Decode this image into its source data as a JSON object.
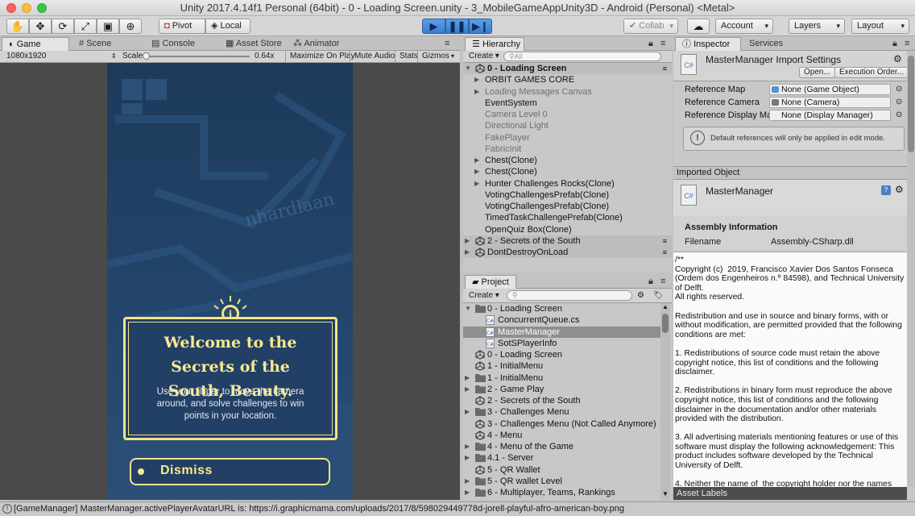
{
  "window": {
    "title": "Unity 2017.4.14f1 Personal (64bit) - 0 - Loading Screen.unity - 3_MobileGameAppUnity3D - Android (Personal) <Metal>"
  },
  "toolbar": {
    "pivot": "Pivot",
    "local": "Local",
    "collab": "Collab",
    "account": "Account",
    "layers": "Layers",
    "layout": "Layout"
  },
  "game": {
    "tabs": [
      "Game",
      "Scene",
      "Console",
      "Asset Store",
      "Animator"
    ],
    "resolution": "1080x1920",
    "scale_label": "Scale",
    "scale_value": "0.64x",
    "options": [
      "Maximize On Play",
      "Mute Audio",
      "Stats",
      "Gizmos"
    ],
    "map_text": "nhardlaan",
    "dialog": {
      "title": "Welcome to the Secrets of the South, Beauty.",
      "body": "Use your finger to move the camera around, and solve challenges to win points in your location."
    },
    "dismiss": "Dismiss"
  },
  "hierarchy": {
    "title": "Hierarchy",
    "create": "Create",
    "search": "All",
    "items": [
      {
        "label": "0 - Loading Screen",
        "depth": 0,
        "arrow": "open",
        "type": "scene",
        "dim": false,
        "bold": true
      },
      {
        "label": "ORBIT GAMES CORE",
        "depth": 1,
        "arrow": "closed",
        "dim": false
      },
      {
        "label": "Loading Messages Canvas",
        "depth": 1,
        "arrow": "closed",
        "dim": true
      },
      {
        "label": "EventSystem",
        "depth": 1,
        "arrow": "",
        "dim": false
      },
      {
        "label": "Camera Level 0",
        "depth": 1,
        "arrow": "",
        "dim": true
      },
      {
        "label": "Directional Light",
        "depth": 1,
        "arrow": "",
        "dim": true
      },
      {
        "label": "FakePlayer",
        "depth": 1,
        "arrow": "",
        "dim": true
      },
      {
        "label": "FabricInit",
        "depth": 1,
        "arrow": "",
        "dim": true
      },
      {
        "label": "Chest(Clone)",
        "depth": 1,
        "arrow": "closed",
        "dim": false
      },
      {
        "label": "Chest(Clone)",
        "depth": 1,
        "arrow": "closed",
        "dim": false
      },
      {
        "label": "Hunter Challenges Rocks(Clone)",
        "depth": 1,
        "arrow": "closed",
        "dim": false
      },
      {
        "label": "VotingChallengesPrefab(Clone)",
        "depth": 1,
        "arrow": "",
        "dim": false
      },
      {
        "label": "VotingChallengesPrefab(Clone)",
        "depth": 1,
        "arrow": "",
        "dim": false
      },
      {
        "label": "TimedTaskChallengePrefab(Clone)",
        "depth": 1,
        "arrow": "",
        "dim": false
      },
      {
        "label": "OpenQuiz Box(Clone)",
        "depth": 1,
        "arrow": "",
        "dim": false
      },
      {
        "label": "2 - Secrets of the South",
        "depth": 0,
        "arrow": "closed",
        "type": "scene",
        "dim": false
      },
      {
        "label": "DontDestroyOnLoad",
        "depth": 0,
        "arrow": "closed",
        "type": "scene",
        "dim": false
      }
    ]
  },
  "project": {
    "title": "Project",
    "create": "Create",
    "items": [
      {
        "label": "0 - Loading Screen",
        "depth": 0,
        "arrow": "open",
        "type": "folder"
      },
      {
        "label": "ConcurrentQueue.cs",
        "depth": 1,
        "arrow": "",
        "type": "script"
      },
      {
        "label": "MasterManager",
        "depth": 1,
        "arrow": "",
        "type": "script",
        "selected": true
      },
      {
        "label": "SotSPlayerInfo",
        "depth": 1,
        "arrow": "",
        "type": "script"
      },
      {
        "label": "0 - Loading Screen",
        "depth": 0,
        "arrow": "",
        "type": "scene"
      },
      {
        "label": "1 - InitialMenu",
        "depth": 0,
        "arrow": "",
        "type": "scene"
      },
      {
        "label": "1 - InitialMenu",
        "depth": 0,
        "arrow": "closed",
        "type": "folder"
      },
      {
        "label": "2 - Game Play",
        "depth": 0,
        "arrow": "closed",
        "type": "folder"
      },
      {
        "label": "2 - Secrets of the South",
        "depth": 0,
        "arrow": "",
        "type": "scene"
      },
      {
        "label": "3 - Challenges Menu",
        "depth": 0,
        "arrow": "closed",
        "type": "folder"
      },
      {
        "label": "3 - Challenges Menu (Not Called Anymore)",
        "depth": 0,
        "arrow": "",
        "type": "scene"
      },
      {
        "label": "4 - Menu",
        "depth": 0,
        "arrow": "",
        "type": "scene"
      },
      {
        "label": "4 - Menu of the Game",
        "depth": 0,
        "arrow": "closed",
        "type": "folder"
      },
      {
        "label": "4.1 - Server",
        "depth": 0,
        "arrow": "closed",
        "type": "folder"
      },
      {
        "label": "5 - QR Wallet",
        "depth": 0,
        "arrow": "",
        "type": "scene"
      },
      {
        "label": "5 - QR wallet Level",
        "depth": 0,
        "arrow": "closed",
        "type": "folder"
      },
      {
        "label": "6 - Multiplayer, Teams, Rankings",
        "depth": 0,
        "arrow": "closed",
        "type": "folder"
      }
    ]
  },
  "inspector": {
    "tabs": [
      "Inspector",
      "Services"
    ],
    "header": "MasterManager Import Settings",
    "open_btn": "Open...",
    "exec_btn": "Execution Order...",
    "fields": [
      {
        "label": "Reference Map",
        "value": "None (Game Object)"
      },
      {
        "label": "Reference Camera",
        "value": "None (Camera)"
      },
      {
        "label": "Reference Display Mar",
        "value": "None (Display Manager)"
      }
    ],
    "note": "Default references will only be applied in edit mode.",
    "imported_object": "Imported Object",
    "object_name": "MasterManager",
    "assembly_info": "Assembly Information",
    "filename_label": "Filename",
    "filename_value": "Assembly-CSharp.dll",
    "license": "/**\nCopyright (c)  2019, Francisco Xavier Dos Santos Fonseca (Ordem dos Engenheiros n.º 84598), and Technical University of Delft.\nAll rights reserved.\n\nRedistribution and use in source and binary forms, with or without modification, are permitted provided that the following conditions are met:\n\n1. Redistributions of source code must retain the above copyright notice, this list of conditions and the following disclaimer.\n\n2. Redistributions in binary form must reproduce the above copyright notice, this list of conditions and the following disclaimer in the documentation and/or other materials provided with the distribution.\n\n3. All advertising materials mentioning features or use of this software must display the following acknowledgement: This product includes software developed by the Technical University of Delft.\n\n4. Neither the name of  the copyright holder nor the names",
    "asset_labels": "Asset Labels"
  },
  "status": {
    "message": "[GameManager] MasterManager.activePlayerAvatarURL is: https://i.graphicmama.com/uploads/2017/8/598029449778d-jorell-playful-afro-american-boy.png"
  }
}
